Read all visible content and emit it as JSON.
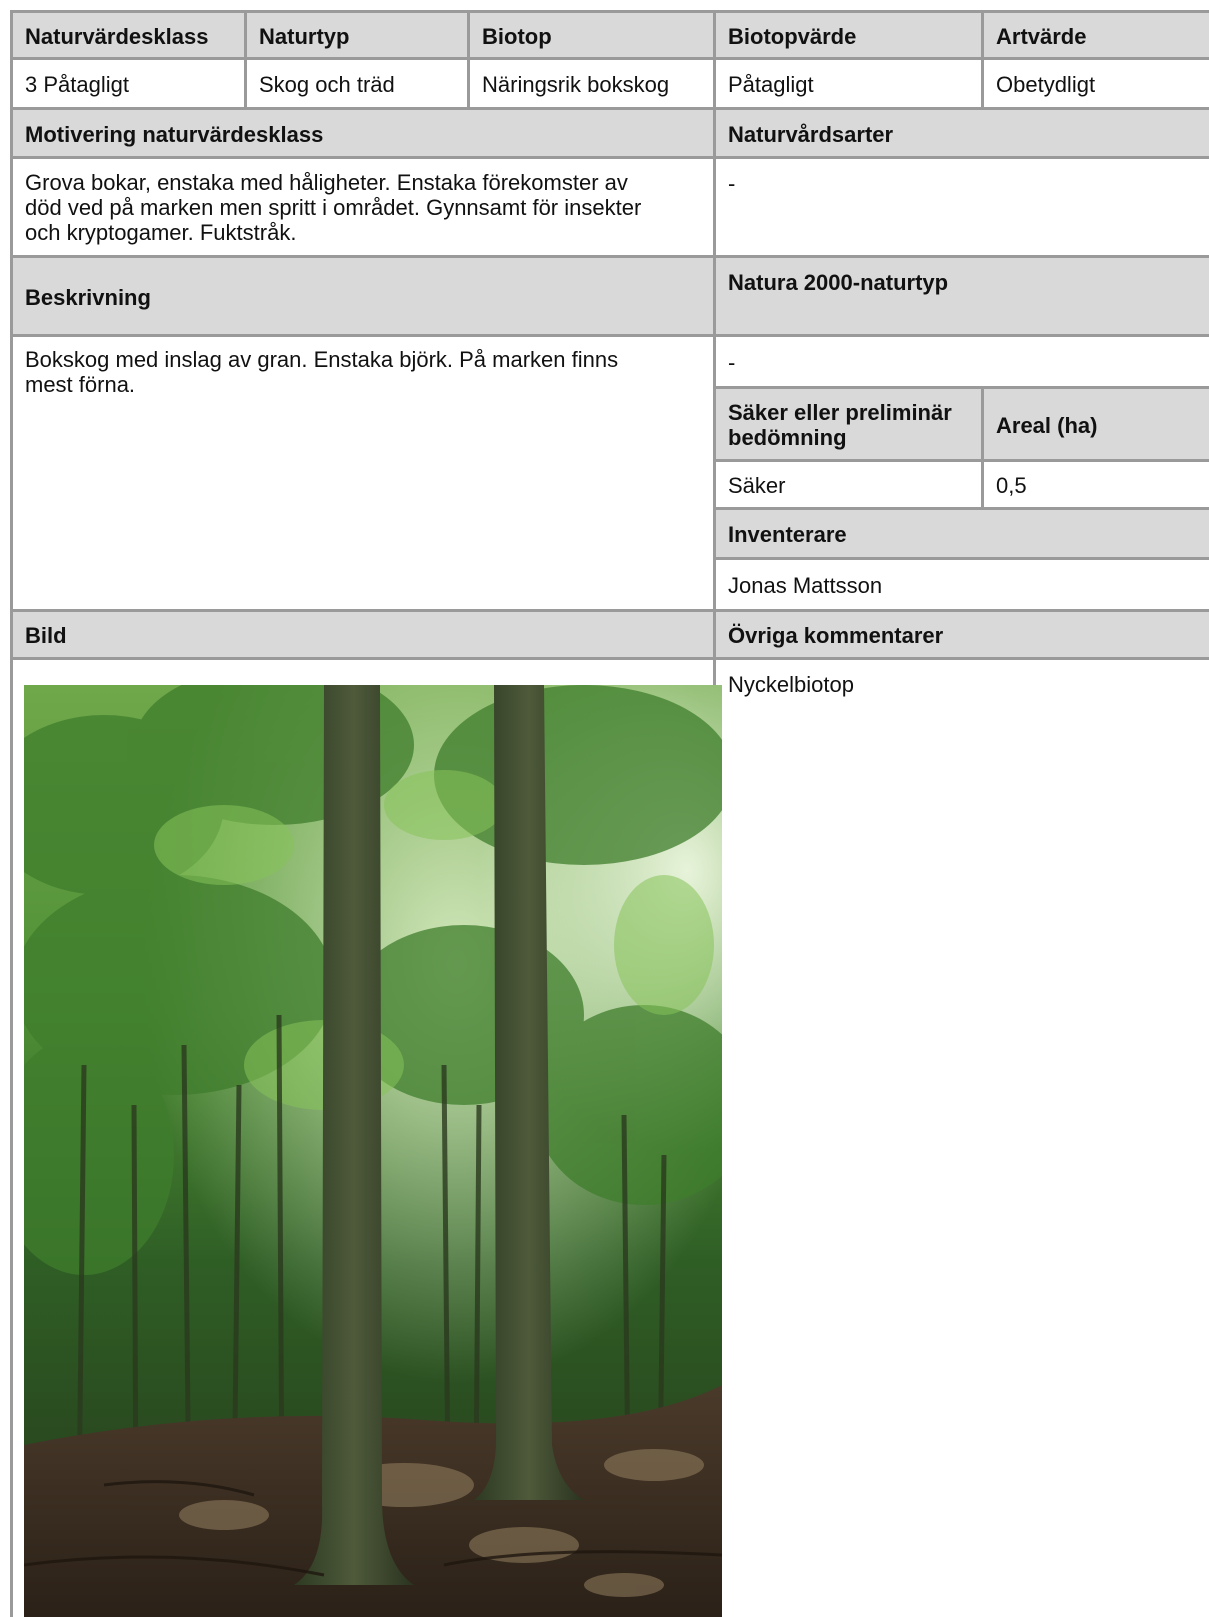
{
  "table": {
    "row1_headers": [
      "Naturvärdesklass",
      "Naturtyp",
      "Biotop",
      "Biotopvärde",
      "Artvärde"
    ],
    "row1_values": [
      "3 Påtagligt",
      "Skog och träd",
      "Näringsrik bokskog",
      "Påtagligt",
      "Obetydligt"
    ],
    "motivering": {
      "header": "Motivering naturvärdesklass",
      "text": "Grova bokar, enstaka med håligheter. Enstaka förekomster av\ndöd ved på marken men spritt i området. Gynnsamt för insekter\noch kryptogamer. Fuktstråk."
    },
    "naturvardsarter": {
      "header": "Naturvårdsarter",
      "value": "-"
    },
    "beskrivning": {
      "header": "Beskrivning",
      "text": "Bokskog med inslag av gran. Enstaka björk. På marken finns\nmest förna."
    },
    "natura2000": {
      "header": "Natura 2000-naturtyp",
      "value": "-"
    },
    "bedomning": {
      "header": "Säker eller preliminär\nbedömning",
      "value": "Säker"
    },
    "areal": {
      "header": "Areal (ha)",
      "value": "0,5"
    },
    "inventerare": {
      "header": "Inventerare",
      "value": "Jonas Mattsson"
    },
    "bild": {
      "header": "Bild"
    },
    "ovriga": {
      "header": "Övriga kommentarer",
      "value": "Nyckelbiotop"
    }
  },
  "colors": {
    "header_bg": "#d9d9d9",
    "border": "#9a9a9a"
  },
  "image": {
    "subject": "beech forest photo"
  }
}
